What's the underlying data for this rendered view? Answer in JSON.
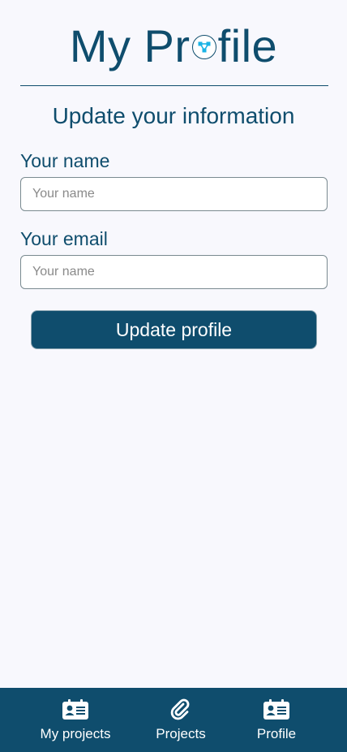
{
  "header": {
    "title_before": "My Pr",
    "title_after": "file",
    "logo_icon": "network-nodes-icon"
  },
  "form": {
    "heading": "Update your information",
    "name_label": "Your name",
    "name_placeholder": "Your name",
    "name_value": "",
    "email_label": "Your email",
    "email_placeholder": "Your name",
    "email_value": "",
    "submit_label": "Update profile"
  },
  "nav": {
    "items": [
      {
        "label": "My projects",
        "icon": "id-card-icon"
      },
      {
        "label": "Projects",
        "icon": "paperclip-icon"
      },
      {
        "label": "Profile",
        "icon": "id-card-icon"
      }
    ]
  },
  "colors": {
    "primary": "#0f4d6d",
    "background": "#f8f8fd",
    "logo_accent": "#1ab3e6"
  }
}
